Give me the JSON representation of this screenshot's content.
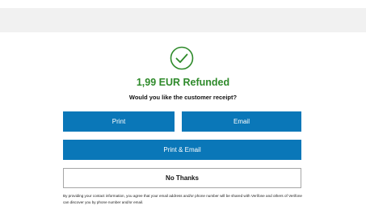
{
  "header": {
    "bar_color": "#f1f1f1"
  },
  "status": {
    "icon": "checkmark-circle-icon",
    "title": "1,99 EUR Refunded",
    "title_color": "#2e8a2a",
    "question": "Would you like the customer receipt?"
  },
  "buttons": {
    "print": "Print",
    "email": "Email",
    "print_email": "Print & Email",
    "no_thanks": "No Thanks",
    "primary_color": "#0a77b8"
  },
  "disclaimer": "By providing your contact information, you agree that your email address and/or phone number will be shared with Verifone and others of Verifone can discover you by phone number and/or email."
}
